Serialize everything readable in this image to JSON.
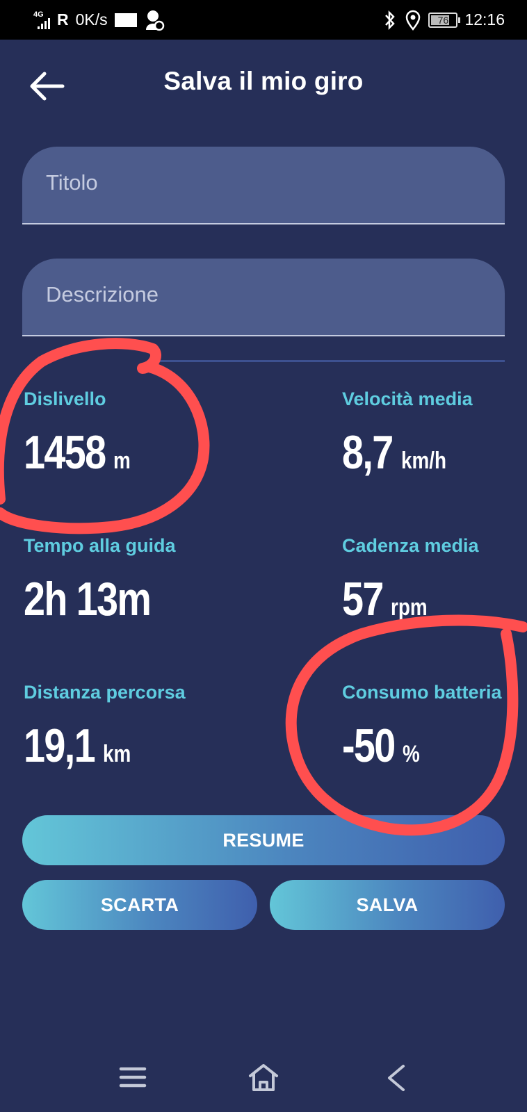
{
  "status_bar": {
    "network": "4G",
    "roaming": "R",
    "speed": "0K/s",
    "battery": "76",
    "time": "12:16"
  },
  "header": {
    "title": "Salva il mio giro",
    "back_icon": "arrow-left-icon"
  },
  "form": {
    "title_placeholder": "Titolo",
    "description_placeholder": "Descrizione"
  },
  "stats": {
    "elevation": {
      "label": "Dislivello",
      "value": "1458",
      "unit": "m"
    },
    "avg_speed": {
      "label": "Velocità media",
      "value": "8,7",
      "unit": "km/h"
    },
    "ride_time": {
      "label": "Tempo alla guida",
      "value": "2h 13m",
      "unit": ""
    },
    "avg_cadence": {
      "label": "Cadenza media",
      "value": "57",
      "unit": "rpm"
    },
    "distance": {
      "label": "Distanza percorsa",
      "value": "19,1",
      "unit": "km"
    },
    "battery_use": {
      "label": "Consumo batteria",
      "value": "-50",
      "unit": "%"
    }
  },
  "buttons": {
    "resume": "RESUME",
    "discard": "SCARTA",
    "save": "SALVA"
  },
  "colors": {
    "background": "#262f58",
    "accent_label": "#5fcde0",
    "field_bg": "#4d5c8c",
    "annotation": "#ff4f4f"
  }
}
